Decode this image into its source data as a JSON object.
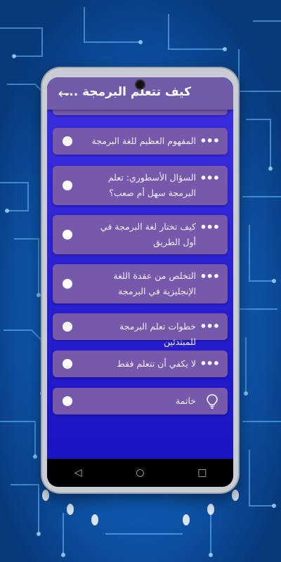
{
  "app": {
    "title": "كيف تتعلم البرمجة ...",
    "back_icon": "arrow-left-icon"
  },
  "items": [
    {
      "label": "المفهوم العظيم للغة البرمجة",
      "icon": "more-dots-icon"
    },
    {
      "label": "السؤال الأسطوري: تعلم البرمجة سهل أم صعب؟",
      "icon": "more-dots-icon"
    },
    {
      "label": "كيف تختار لغة البرمجة في أول الطريق",
      "icon": "more-dots-icon"
    },
    {
      "label": "التخلص من عقدة اللغة الإنجليزية في البرمجة",
      "icon": "more-dots-icon"
    },
    {
      "label": "خطوات تعلم البرمجة للمبتدئين",
      "icon": "more-dots-icon"
    },
    {
      "label": "لا يكفي أن تتعلم فقط",
      "icon": "more-dots-icon"
    },
    {
      "label": "خاتمة",
      "icon": "lightbulb-icon"
    }
  ],
  "navbar": {
    "back": "◁",
    "home": "○",
    "recents": "□"
  }
}
